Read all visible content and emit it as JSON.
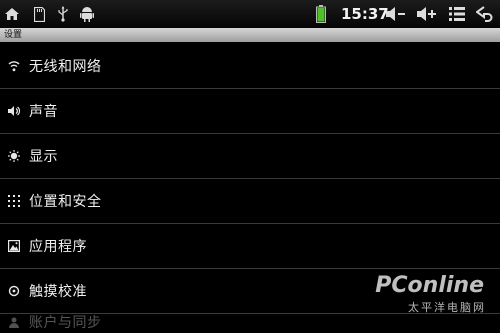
{
  "status_bar": {
    "icons": [
      "home-icon",
      "sd-card-icon",
      "usb-icon",
      "android-debug-icon",
      "battery-icon",
      "volume-down-icon",
      "volume-up-icon",
      "menu-icon",
      "back-icon"
    ],
    "time": "15:37",
    "battery_color": "#4fc02a"
  },
  "title_bar": {
    "title": "设置"
  },
  "settings": {
    "items": [
      {
        "label": "无线和网络",
        "icon": "wifi-icon"
      },
      {
        "label": "声音",
        "icon": "speaker-icon"
      },
      {
        "label": "显示",
        "icon": "brightness-icon"
      },
      {
        "label": "位置和安全",
        "icon": "location-security-icon"
      },
      {
        "label": "应用程序",
        "icon": "applications-icon"
      },
      {
        "label": "触摸校准",
        "icon": "touch-calibration-icon"
      },
      {
        "label": "账户与同步",
        "icon": "accounts-icon"
      }
    ]
  },
  "watermark": {
    "logo": "PConline",
    "subtitle": "太平洋电脑网"
  }
}
